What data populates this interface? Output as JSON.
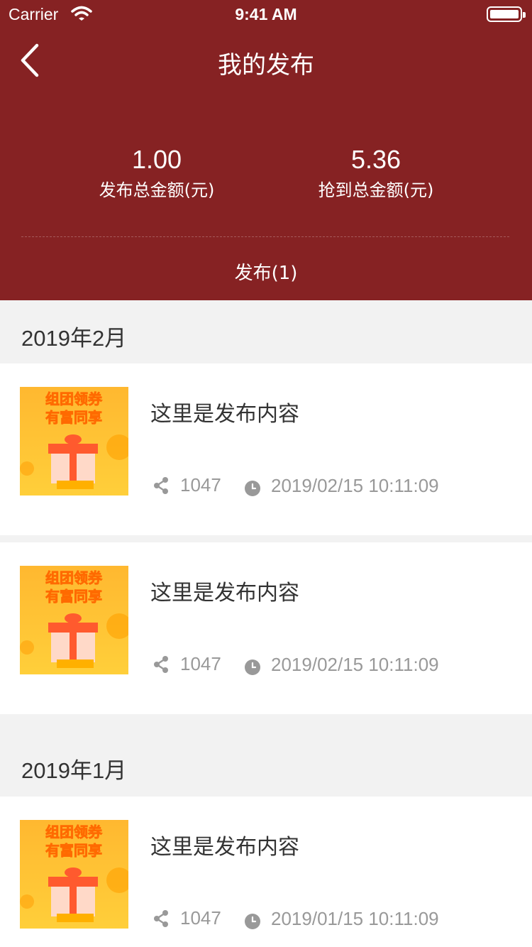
{
  "status_bar": {
    "carrier": "Carrier",
    "time": "9:41 AM"
  },
  "nav": {
    "title": "我的发布"
  },
  "stats": {
    "published": {
      "value": "1.00",
      "label": "发布总金额(元)"
    },
    "grabbed": {
      "value": "5.36",
      "label": "抢到总金额(元)"
    }
  },
  "tab": {
    "label": "发布(1)"
  },
  "sections": [
    {
      "month": "2019年2月",
      "items": [
        {
          "text": "这里是发布内容",
          "shares": "1047",
          "date": "2019/02/15 10:11:09"
        },
        {
          "text": "这里是发布内容",
          "shares": "1047",
          "date": "2019/02/15 10:11:09"
        }
      ]
    },
    {
      "month": "2019年1月",
      "items": [
        {
          "text": "这里是发布内容",
          "shares": "1047",
          "date": "2019/01/15 10:11:09"
        }
      ]
    }
  ],
  "thumbnail": {
    "line1": "组团领券",
    "line2": "有富同享"
  },
  "colors": {
    "header_bg": "#862223",
    "page_bg": "#f2f2f2",
    "meta_text": "#999999"
  }
}
